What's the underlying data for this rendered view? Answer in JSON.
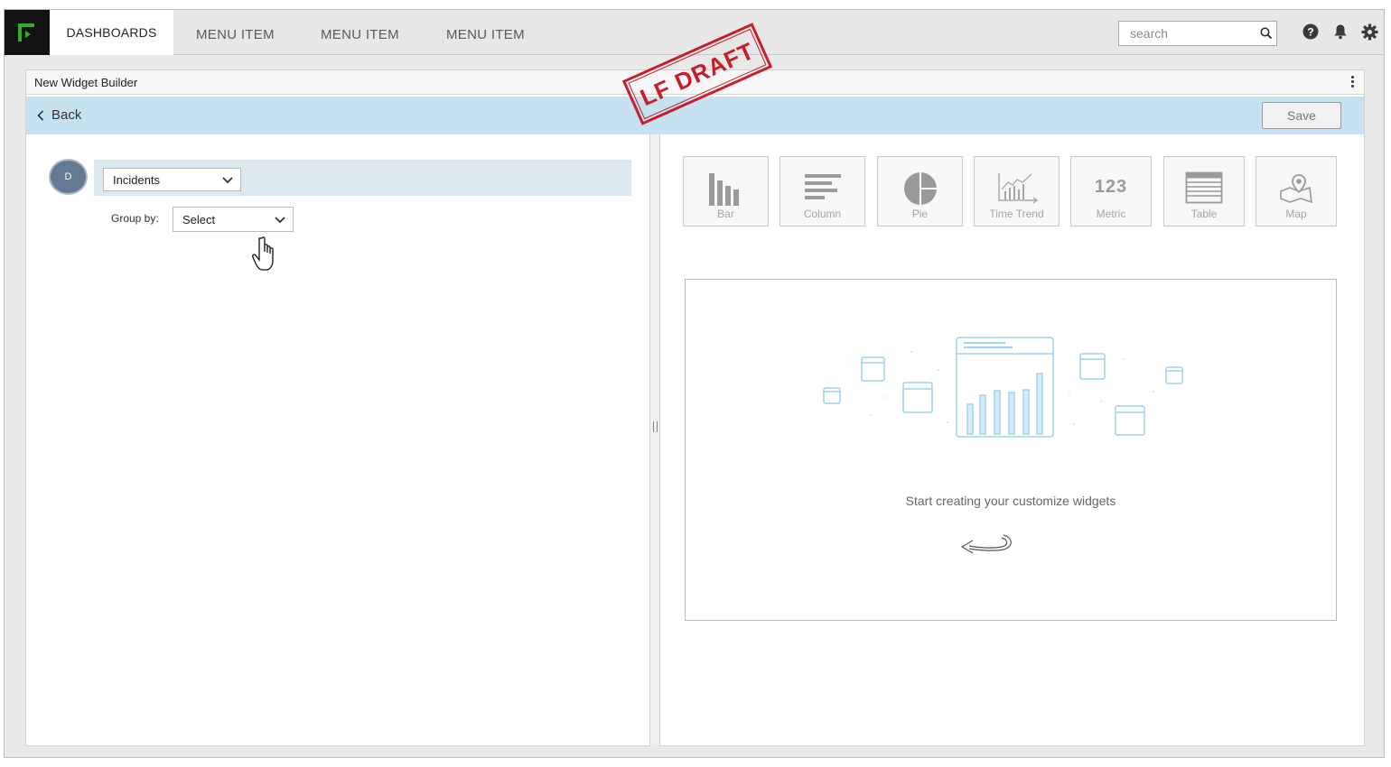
{
  "topbar": {
    "active_tab": "DASHBOARDS",
    "menu_items": [
      "MENU ITEM",
      "MENU ITEM",
      "MENU ITEM"
    ],
    "search_placeholder": "search",
    "icons": [
      "help-icon",
      "bell-icon",
      "gear-icon"
    ]
  },
  "panel": {
    "title": "New Widget Builder",
    "back_label": "Back",
    "save_label": "Save"
  },
  "builder": {
    "avatar_letter": "D",
    "datasource": "Incidents",
    "group_by_label": "Group by:",
    "group_by_value": "Select"
  },
  "chart_types": [
    {
      "label": "Bar",
      "icon": "bar-chart-icon"
    },
    {
      "label": "Column",
      "icon": "column-chart-icon"
    },
    {
      "label": "Pie",
      "icon": "pie-chart-icon"
    },
    {
      "label": "Time Trend",
      "icon": "time-trend-icon"
    },
    {
      "label": "Metric",
      "icon": "metric-icon",
      "glyph": "123"
    },
    {
      "label": "Table",
      "icon": "table-icon"
    },
    {
      "label": "Map",
      "icon": "map-icon"
    }
  ],
  "preview": {
    "empty_text": "Start creating your customize widgets"
  },
  "stamp": {
    "text": "LF DRAFT"
  },
  "colors": {
    "accent_green": "#2fb11f",
    "backbar": "#c6e2f1",
    "datasource_row": "#dce9f1",
    "avatar": "#627a93",
    "stamp_red": "#c81e2b",
    "illustration_blue": "#9fd2ef"
  }
}
